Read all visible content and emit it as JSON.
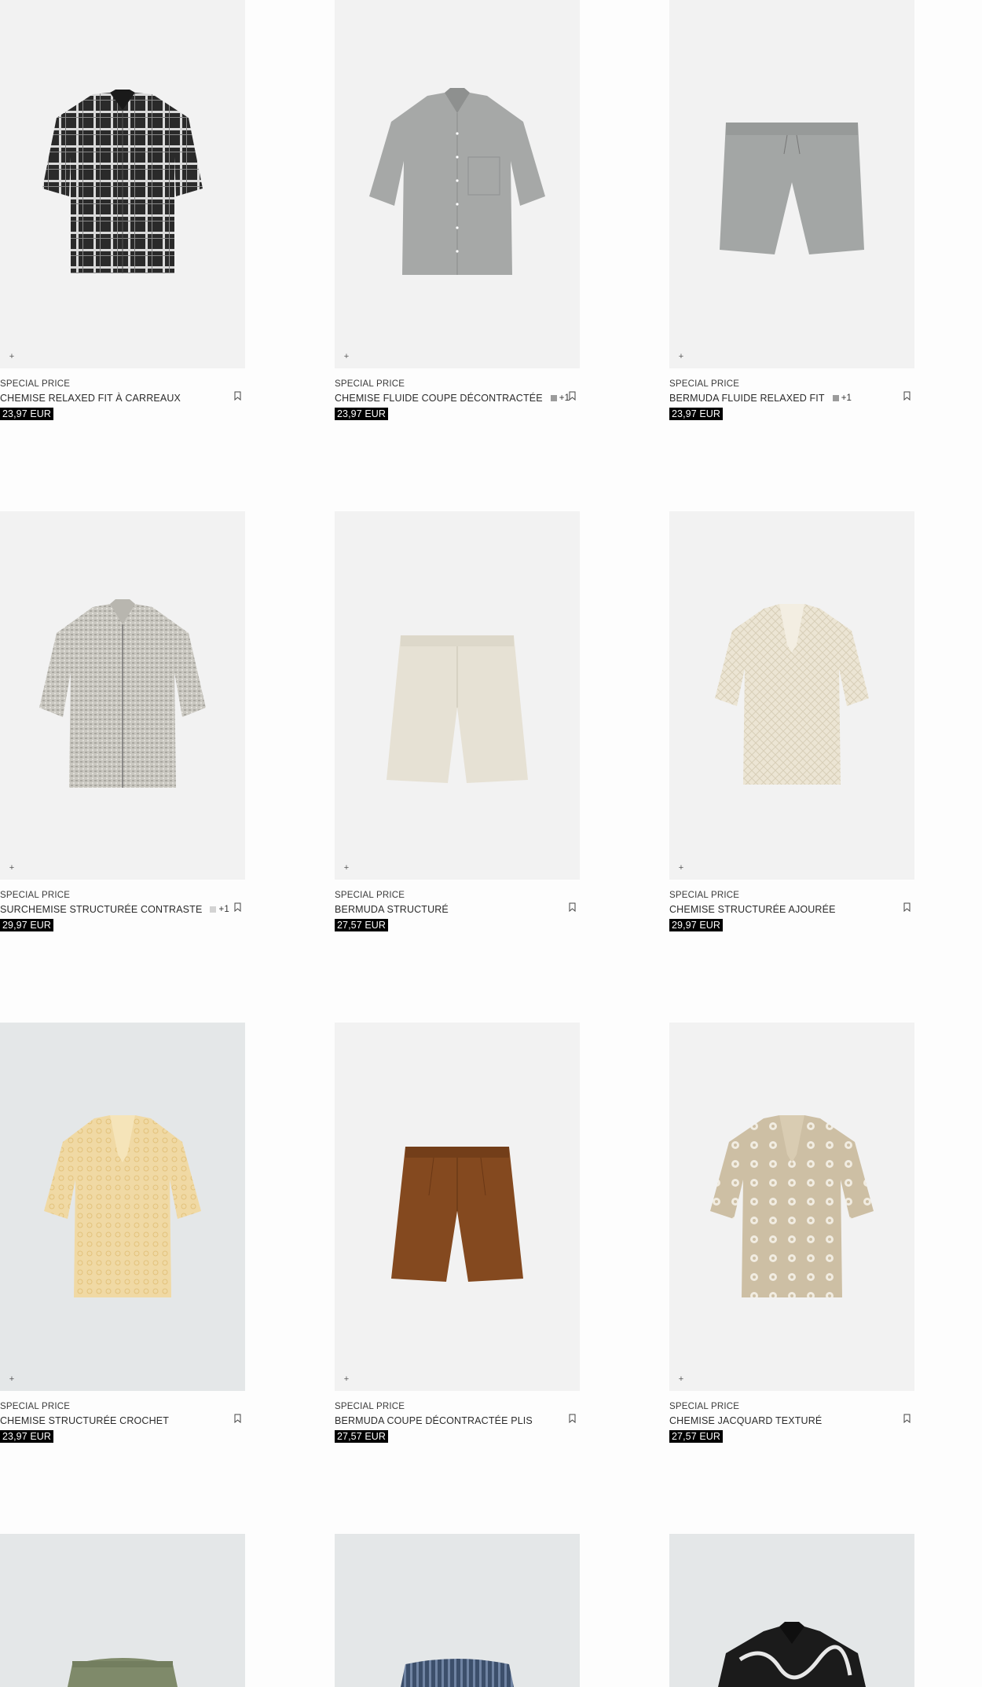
{
  "products": [
    {
      "badge": "SPECIAL PRICE",
      "name": "CHEMISE RELAXED FIT À CARREAUX",
      "price": "23,97 EUR",
      "swatch_color": "",
      "swatch_more": "",
      "image": "black-white-plaid-short-sleeve-shirt",
      "bg": "#f2f2f2"
    },
    {
      "badge": "SPECIAL PRICE",
      "name": "CHEMISE FLUIDE COUPE DÉCONTRACTÉE",
      "price": "23,97 EUR",
      "swatch_color": "#9b9b9b",
      "swatch_more": "+1",
      "image": "grey-short-sleeve-shirt",
      "bg": "#f2f2f2"
    },
    {
      "badge": "SPECIAL PRICE",
      "name": "BERMUDA FLUIDE RELAXED FIT",
      "price": "23,97 EUR",
      "swatch_color": "#9b9b9b",
      "swatch_more": "+1",
      "image": "grey-bermuda-shorts",
      "bg": "#f2f2f2"
    },
    {
      "badge": "SPECIAL PRICE",
      "name": "SURCHEMISE STRUCTURÉE CONTRASTE",
      "price": "29,97 EUR",
      "swatch_color": "#d3d3d3",
      "swatch_more": "+1",
      "image": "grey-textured-overshirt",
      "bg": "#f2f2f2"
    },
    {
      "badge": "SPECIAL PRICE",
      "name": "BERMUDA STRUCTURÉ",
      "price": "27,57 EUR",
      "swatch_color": "",
      "swatch_more": "",
      "image": "ecru-bermuda-shorts",
      "bg": "#f2f2f2"
    },
    {
      "badge": "SPECIAL PRICE",
      "name": "CHEMISE STRUCTURÉE AJOURÉE",
      "price": "29,97 EUR",
      "swatch_color": "",
      "swatch_more": "",
      "image": "cream-openwork-shirt",
      "bg": "#f2f2f2"
    },
    {
      "badge": "SPECIAL PRICE",
      "name": "CHEMISE STRUCTURÉE CROCHET",
      "price": "23,97 EUR",
      "swatch_color": "",
      "swatch_more": "",
      "image": "yellow-crochet-shirt",
      "bg": "#e4e7e8"
    },
    {
      "badge": "SPECIAL PRICE",
      "name": "BERMUDA COUPE DÉCONTRACTÉE PLIS",
      "price": "27,57 EUR",
      "swatch_color": "",
      "swatch_more": "",
      "image": "brown-pleated-bermuda",
      "bg": "#f2f2f2"
    },
    {
      "badge": "SPECIAL PRICE",
      "name": "CHEMISE JACQUARD TEXTURÉ",
      "price": "27,57 EUR",
      "swatch_color": "",
      "swatch_more": "",
      "image": "beige-jacquard-shirt",
      "bg": "#f2f2f2"
    },
    {
      "badge": "",
      "name": "",
      "price": "",
      "swatch_color": "",
      "swatch_more": "",
      "image": "khaki-drawstring-shorts",
      "bg": "#e4e7e8"
    },
    {
      "badge": "",
      "name": "",
      "price": "",
      "swatch_color": "",
      "swatch_more": "",
      "image": "blue-striped-shorts",
      "bg": "#e4e7e8"
    },
    {
      "badge": "",
      "name": "",
      "price": "",
      "swatch_color": "",
      "swatch_more": "",
      "image": "black-embroidered-shirt",
      "bg": "#e4e7e8"
    }
  ],
  "icons": {
    "quick_add": "+",
    "bookmark": "bookmark-icon"
  }
}
